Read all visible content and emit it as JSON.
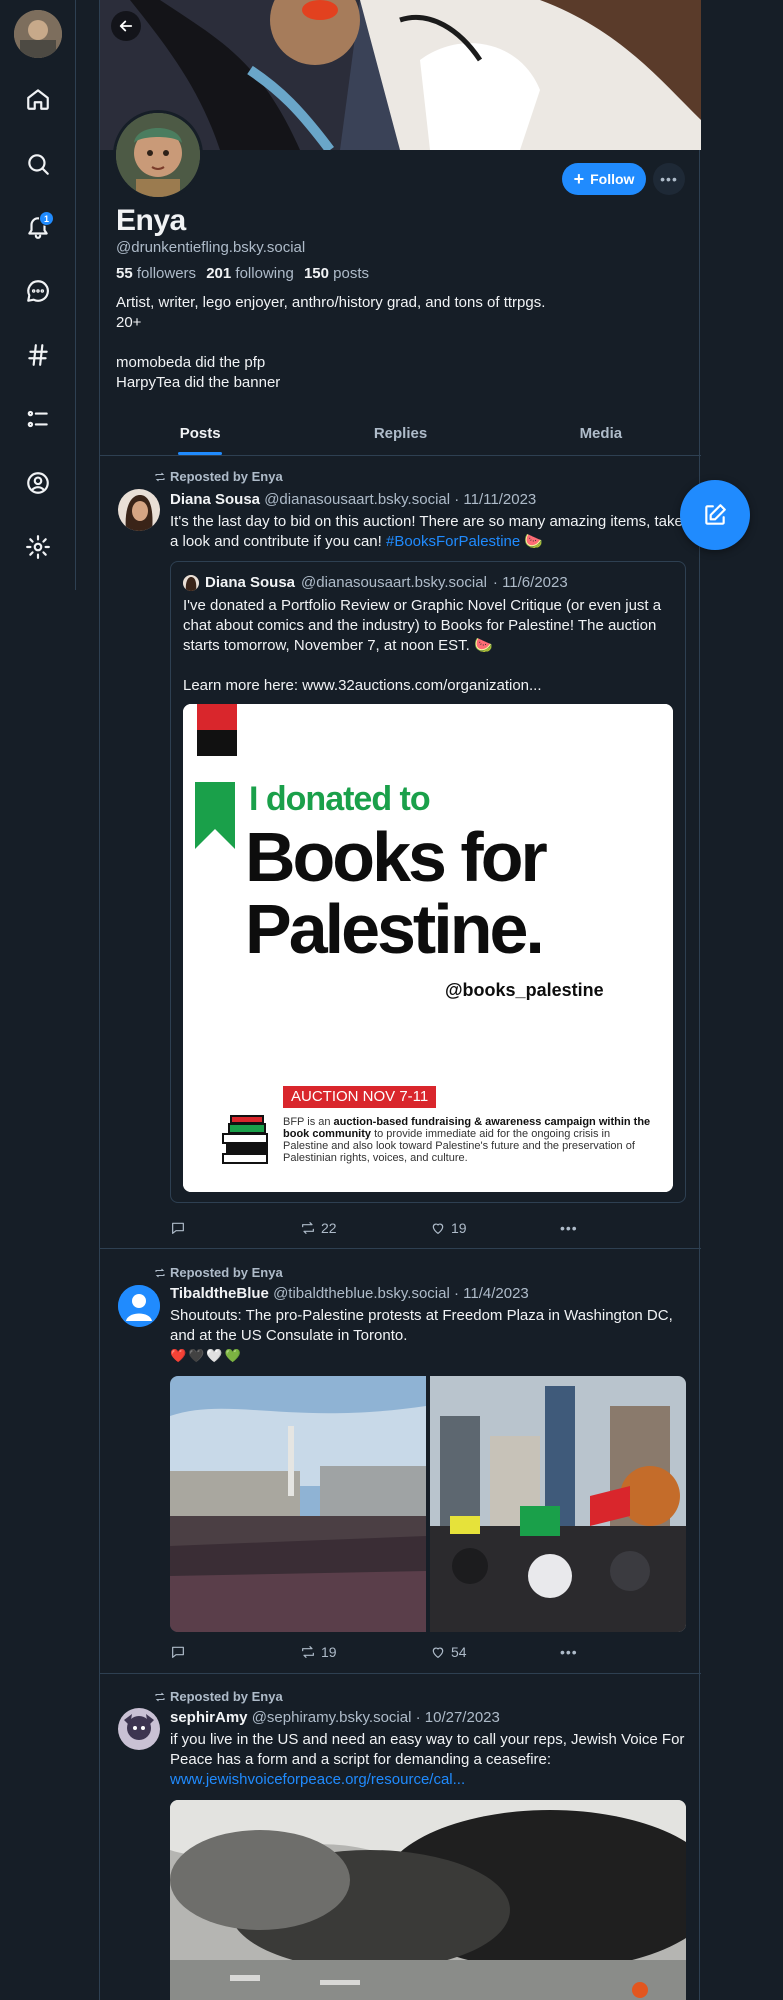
{
  "profile": {
    "display_name": "Enya",
    "handle": "@drunkentiefling.bsky.social",
    "followers_count": "55",
    "followers_label": "followers",
    "following_count": "201",
    "following_label": "following",
    "posts_count": "150",
    "posts_label": "posts",
    "bio_lines": [
      "Artist, writer, lego enjoyer, anthro/history grad, and tons of ttrpgs.",
      "20+",
      "",
      "momobeda did the pfp",
      "HarpyTea did the banner"
    ],
    "follow_label": "Follow"
  },
  "nav": {
    "notification_badge": "1",
    "icons": [
      "home-icon",
      "search-icon",
      "bell-icon",
      "chat-icon",
      "hashtag-icon",
      "list-icon",
      "profile-icon",
      "gear-icon"
    ]
  },
  "tabs": [
    {
      "label": "Posts",
      "active": true
    },
    {
      "label": "Replies",
      "active": false
    },
    {
      "label": "Media",
      "active": false
    }
  ],
  "posts": [
    {
      "repost_label": "Reposted by Enya",
      "author": "Diana Sousa",
      "handle": "@dianasousaart.bsky.social",
      "date": "· 11/11/2023",
      "text": "It's the last day to bid on this auction! There are so many amazing items, take a look and contribute if you can! ",
      "hashtag": "#BooksForPalestine",
      "emoji": " 🍉",
      "quote": {
        "author": "Diana Sousa",
        "handle": "@dianasousaart.bsky.social",
        "date": "· 11/6/2023",
        "text_lines": [
          "I've donated a Portfolio Review or Graphic Novel Critique (or even just a chat about comics and the industry) to Books for Palestine! The auction starts tomorrow, November 7, at noon EST. 🍉",
          "",
          "Learn more here: www.32auctions.com/organization..."
        ],
        "image": {
          "line1": "I donated to",
          "line2": "Books for",
          "line3": "Palestine.",
          "handle": "@books_palestine",
          "auction": "AUCTION NOV 7-11",
          "desc_prefix": "BFP is an ",
          "desc_bold": "auction-based fundraising & awareness campaign within the book community",
          "desc_rest": " to provide immediate aid for the ongoing crisis in Palestine and also look toward Palestine's future and the preservation of Palestinian rights, voices, and culture."
        }
      },
      "reposts": "22",
      "likes": "19"
    },
    {
      "repost_label": "Reposted by Enya",
      "author": "TibaldtheBlue",
      "handle": "@tibaldtheblue.bsky.social",
      "date": "· 11/4/2023",
      "text": "Shoutouts: The pro-Palestine protests at Freedom Plaza in Washington DC, and at the US Consulate in Toronto.",
      "emoji_line": "❤️🖤🤍💚",
      "reposts": "19",
      "likes": "54"
    },
    {
      "repost_label": "Reposted by Enya",
      "author": "sephirAmy",
      "handle": "@sephiramy.bsky.social",
      "date": "· 10/27/2023",
      "text": "if you live in the US and need an easy way to call your reps, Jewish Voice For Peace has a form and a script for demanding a ceasefire:",
      "link": "www.jewishvoiceforpeace.org/resource/cal..."
    }
  ],
  "colors": {
    "background": "#161e27",
    "accent": "#208bfe",
    "border": "#2e4052",
    "muted_text": "#aebbc9"
  }
}
